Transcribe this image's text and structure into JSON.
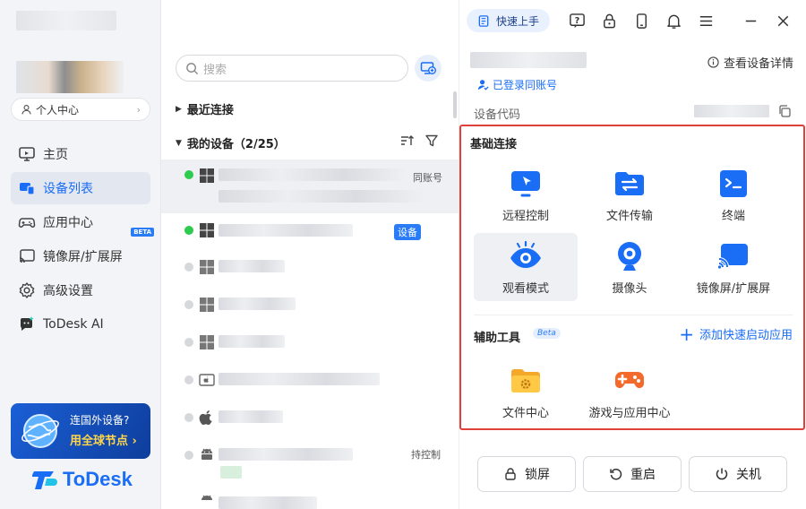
{
  "sidebar": {
    "personal_center": "个人中心",
    "nav": [
      {
        "label": "主页",
        "icon": "monitor-icon"
      },
      {
        "label": "设备列表",
        "icon": "device-list-icon"
      },
      {
        "label": "应用中心",
        "icon": "gamepad-icon",
        "badge": "BETA"
      },
      {
        "label": "镜像屏/扩展屏",
        "icon": "cast-screen-icon"
      },
      {
        "label": "高级设置",
        "icon": "gear-icon"
      },
      {
        "label": "ToDesk AI",
        "icon": "ai-chat-icon"
      }
    ],
    "promo": {
      "line1": "连国外设备?",
      "line2": "用全球节点 ›"
    },
    "brand": "ToDesk"
  },
  "device_list": {
    "search_placeholder": "搜索",
    "recent_label": "最近连接",
    "my_devices_label": "我的设备（2/25）",
    "rows": [
      {
        "online": true,
        "os": "windows",
        "tag": "同账号"
      },
      {
        "online": true,
        "os": "windows",
        "tag": "设备"
      },
      {
        "online": false,
        "os": "windows",
        "tag": ""
      },
      {
        "online": false,
        "os": "windows",
        "tag": ""
      },
      {
        "online": false,
        "os": "windows",
        "tag": ""
      },
      {
        "online": false,
        "os": "mac",
        "tag": ""
      },
      {
        "online": false,
        "os": "apple",
        "tag": ""
      },
      {
        "online": false,
        "os": "android",
        "tag": "持控制"
      }
    ]
  },
  "topbar": {
    "quick_start": "快速上手"
  },
  "detail": {
    "device_detail_link": "查看设备详情",
    "same_account": "已登录同账号",
    "device_code_label": "设备代码"
  },
  "basic": {
    "title": "基础连接",
    "items": [
      {
        "label": "远程控制",
        "icon": "remote-control-icon"
      },
      {
        "label": "文件传输",
        "icon": "file-transfer-icon"
      },
      {
        "label": "终端",
        "icon": "terminal-icon"
      },
      {
        "label": "观看模式",
        "icon": "eye-icon"
      },
      {
        "label": "摄像头",
        "icon": "camera-icon"
      },
      {
        "label": "镜像屏/扩展屏",
        "icon": "cast-icon"
      }
    ]
  },
  "tools": {
    "title": "辅助工具",
    "beta": "Beta",
    "add_link": "添加快速启动应用",
    "items": [
      {
        "label": "文件中心",
        "icon": "folder-gear-icon"
      },
      {
        "label": "游戏与应用中心",
        "icon": "gamepad-icon"
      }
    ]
  },
  "actions": {
    "lock": "锁屏",
    "restart": "重启",
    "shutdown": "关机"
  },
  "colors": {
    "accent": "#1a6df5",
    "highlight_border": "#e0413a",
    "online": "#2dcb4e"
  }
}
